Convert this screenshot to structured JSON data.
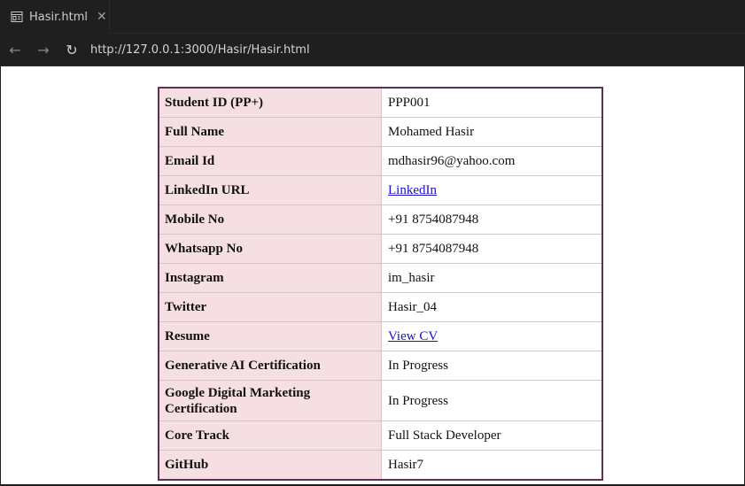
{
  "browser": {
    "tab": {
      "title": "Hasir.html",
      "icon": "page-preview-icon",
      "close_label": "✕"
    },
    "nav": {
      "back_label": "←",
      "forward_label": "→",
      "reload_label": "↻",
      "url": "http://127.0.0.1:3000/Hasir/Hasir.html"
    }
  },
  "table": {
    "rows": [
      {
        "label": "Student ID (PP+)",
        "value": "PPP001",
        "link": false
      },
      {
        "label": "Full Name",
        "value": "Mohamed Hasir",
        "link": false
      },
      {
        "label": "Email Id",
        "value": "mdhasir96@yahoo.com",
        "link": false
      },
      {
        "label": "LinkedIn URL",
        "value": "LinkedIn",
        "link": true
      },
      {
        "label": "Mobile No",
        "value": "+91 8754087948",
        "link": false
      },
      {
        "label": "Whatsapp No",
        "value": "+91 8754087948",
        "link": false
      },
      {
        "label": "Instagram",
        "value": "im_hasir",
        "link": false
      },
      {
        "label": "Twitter",
        "value": "Hasir_04",
        "link": false
      },
      {
        "label": "Resume",
        "value": "View CV",
        "link": true
      },
      {
        "label": "Generative AI Certification",
        "value": "In Progress",
        "link": false
      },
      {
        "label": "Google Digital Marketing Certification",
        "value": "In Progress",
        "link": false
      },
      {
        "label": "Core Track",
        "value": "Full Stack Developer",
        "link": false
      },
      {
        "label": "GitHub",
        "value": "Hasir7",
        "link": false
      }
    ]
  },
  "colors": {
    "label_bg": "#f6dfe2",
    "table_border": "#5a3350",
    "link": "#1a0dcc",
    "chrome_bg": "#1f1f1f"
  }
}
